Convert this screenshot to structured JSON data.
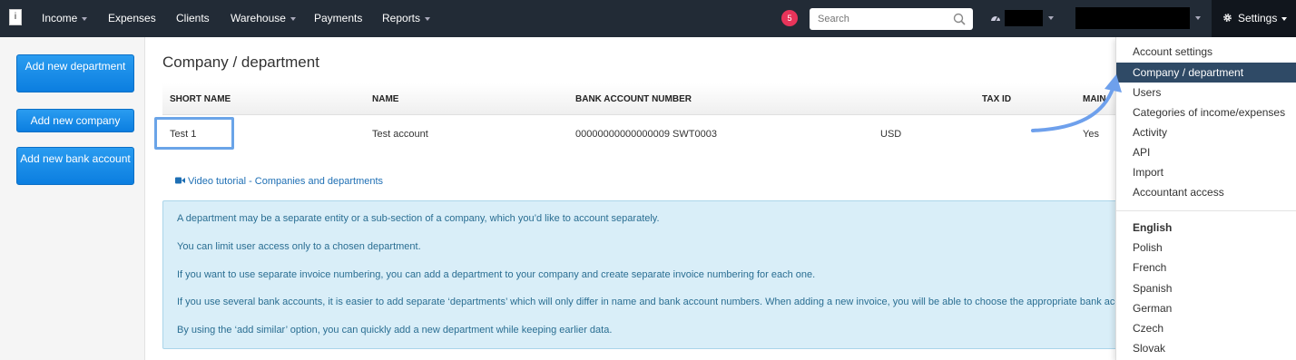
{
  "navbar": {
    "logo": "i",
    "items": [
      {
        "label": "Income",
        "has_caret": true
      },
      {
        "label": "Expenses",
        "has_caret": false
      },
      {
        "label": "Clients",
        "has_caret": false
      },
      {
        "label": "Warehouse",
        "has_caret": true
      },
      {
        "label": "Payments",
        "has_caret": false
      },
      {
        "label": "Reports",
        "has_caret": true
      }
    ],
    "notification_count": "5",
    "search_placeholder": "Search",
    "settings_label": "Settings",
    "icons": [
      "search-icon",
      "dashboard-icon",
      "gear-icon",
      "chevron-down-icon"
    ],
    "accent_color": "#222b36",
    "badge_color": "#e8345a"
  },
  "sidebar": {
    "buttons": [
      "Add new department",
      "Add new company",
      "Add new bank account"
    ]
  },
  "main": {
    "title": "Company / department",
    "table": {
      "headers": [
        "SHORT NAME",
        "NAME",
        "BANK ACCOUNT NUMBER",
        "TAX ID",
        "MAIN"
      ],
      "rows": [
        {
          "short_name": "Test 1",
          "name": "Test account",
          "bank_account": "00000000000000009 SWT0003",
          "currency": "USD",
          "main": "Yes"
        }
      ]
    },
    "video_link": "Video tutorial - Companies and departments",
    "info_lines": [
      "A department may be a separate entity or a sub-section of a company, which you’d like to account separately.",
      "You can limit user access only to a chosen department.",
      "If you want to use separate invoice numbering, you can add a department to your company and create separate invoice numbering for each one.",
      "If you use several bank accounts, it is easier to add separate ‘departments’ which will only differ in name and bank account numbers. When adding a new invoice, you will be able to choose the appropriate bank account.",
      "By using the ‘add similar’ option, you can quickly add a new department while keeping earlier data."
    ]
  },
  "settings_menu": {
    "items": [
      "Account settings",
      "Company / department",
      "Users",
      "Categories of income/expenses",
      "Activity",
      "API",
      "Import",
      "Accountant access"
    ],
    "active_item": "Company / department",
    "languages": [
      "English",
      "Polish",
      "French",
      "Spanish",
      "German",
      "Czech",
      "Slovak"
    ],
    "current_language": "English"
  }
}
